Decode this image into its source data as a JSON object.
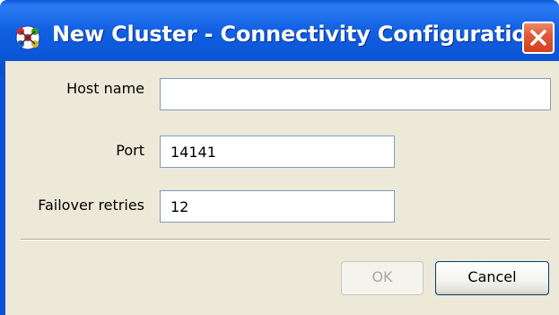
{
  "window": {
    "title": "New Cluster - Connectivity Configuration",
    "app_icon": "cluster-app-icon",
    "close_icon": "close-icon"
  },
  "form": {
    "host_name": {
      "label": "Host name",
      "value": ""
    },
    "port": {
      "label": "Port",
      "value": "14141"
    },
    "failover_retries": {
      "label": "Failover retries",
      "value": "12"
    }
  },
  "buttons": {
    "ok": {
      "label": "OK",
      "enabled": false
    },
    "cancel": {
      "label": "Cancel",
      "enabled": true
    }
  },
  "colors": {
    "titlebar": "#0a53d6",
    "client": "#ece9d8",
    "close_button": "#e2593a",
    "field_border": "#7f9db9",
    "disabled_text": "#aca899"
  }
}
